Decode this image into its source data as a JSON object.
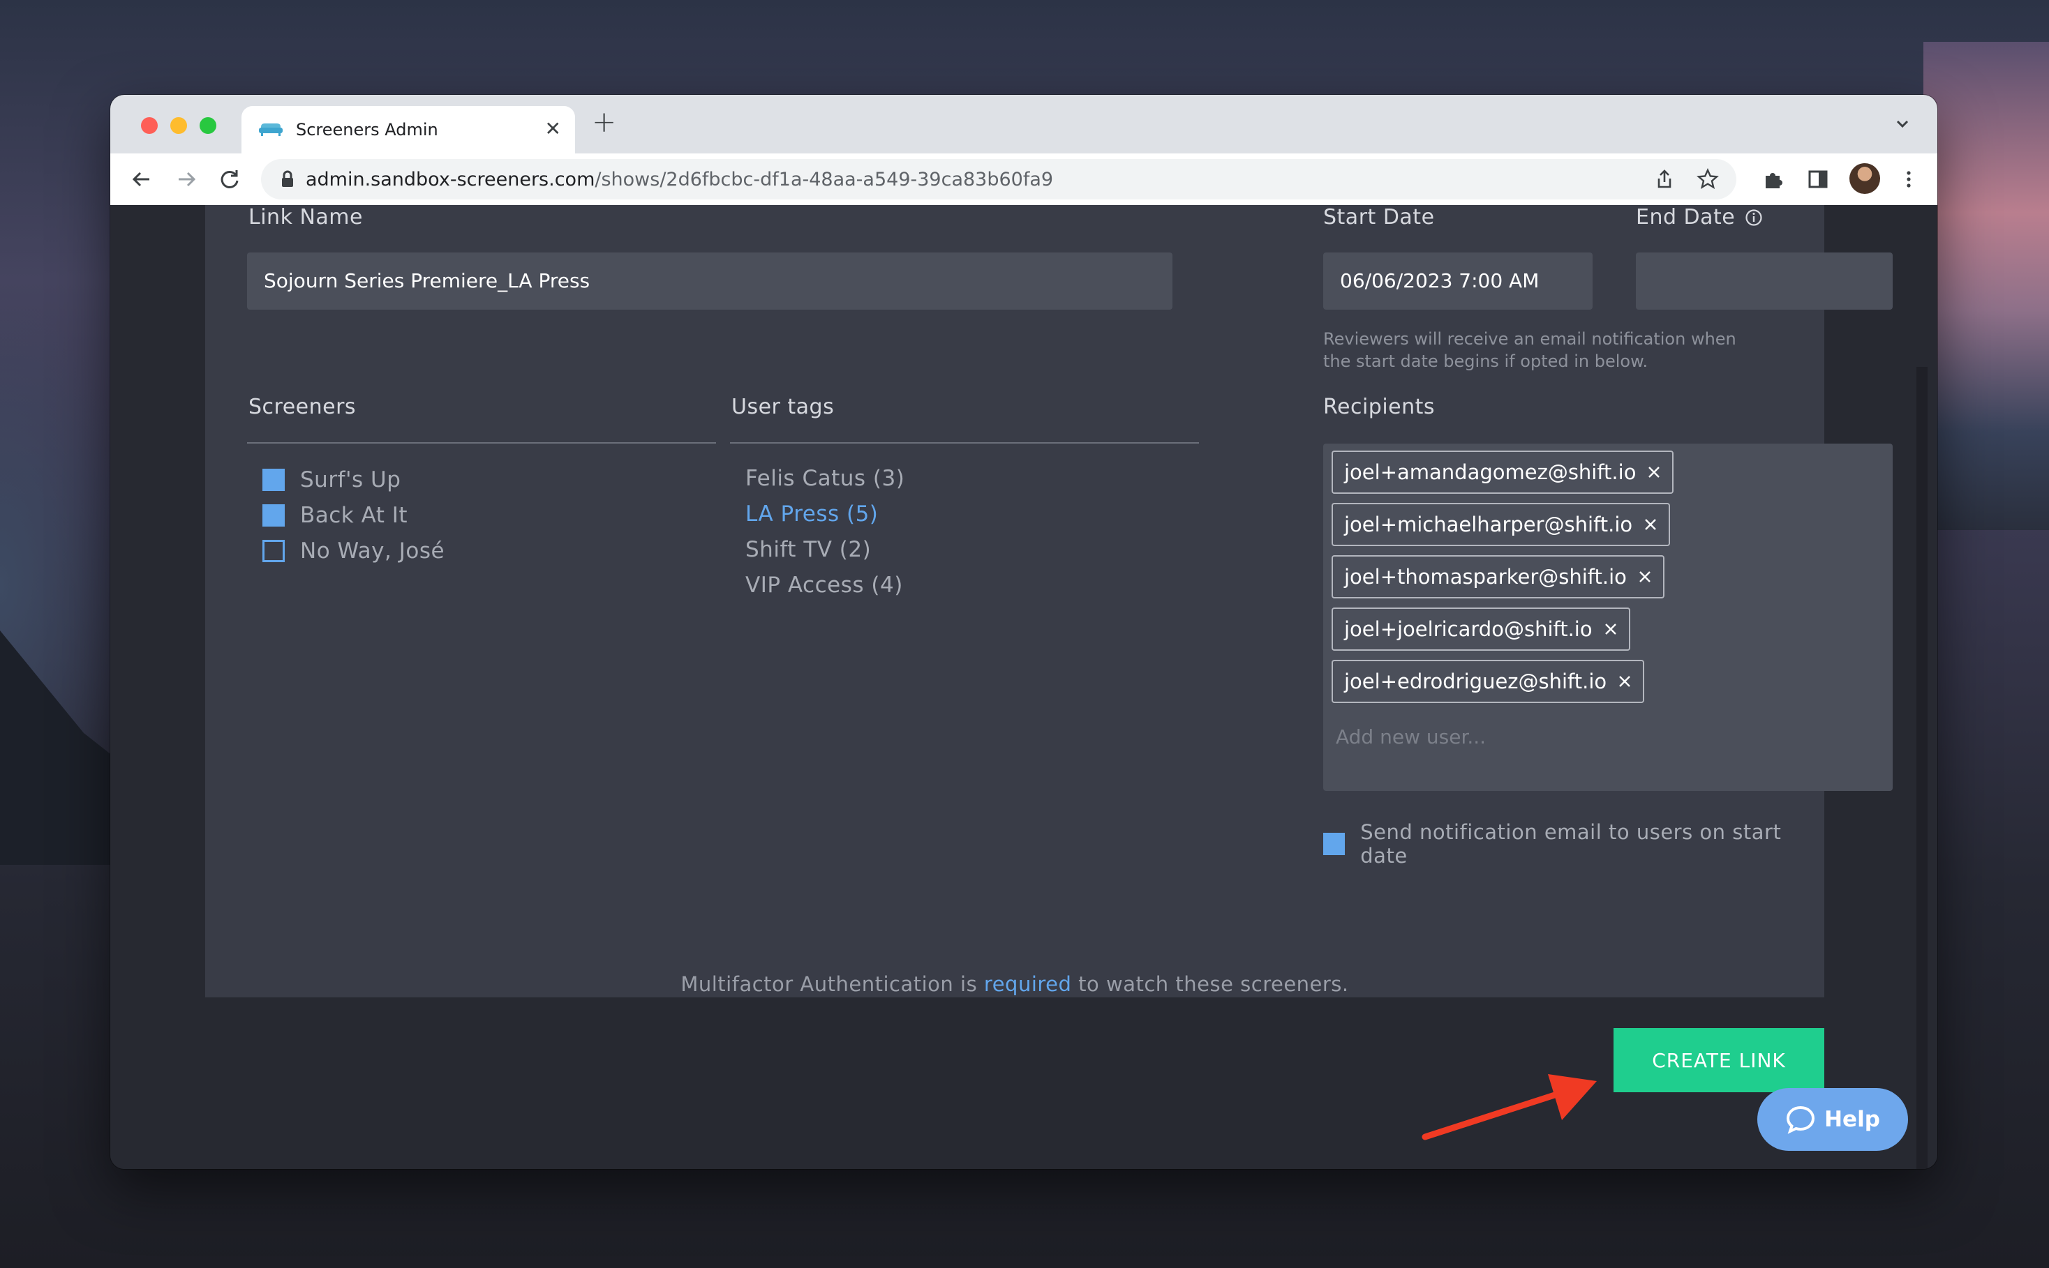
{
  "browser": {
    "tab_title": "Screeners Admin",
    "tab_close": "✕",
    "new_tab": "+",
    "url_host": "admin.sandbox-screeners.com",
    "url_path": "/shows/2d6fbcbc-df1a-48aa-a549-39ca83b60fa9"
  },
  "form": {
    "link_name_label": "Link Name",
    "link_name_value": "Sojourn Series Premiere_LA Press",
    "start_date_label": "Start Date",
    "start_date_value": "06/06/2023 7:00 AM",
    "end_date_label": "End Date",
    "end_date_value": "",
    "start_date_hint": "Reviewers will receive an email notification when the start date begins if opted in below."
  },
  "screeners": {
    "label": "Screeners",
    "items": [
      {
        "label": "Surf's Up",
        "checked": true
      },
      {
        "label": "Back At It",
        "checked": true
      },
      {
        "label": "No Way, José",
        "checked": false
      }
    ]
  },
  "user_tags": {
    "label": "User tags",
    "items": [
      {
        "label": "Felis Catus (3)",
        "active": false
      },
      {
        "label": "LA Press (5)",
        "active": true
      },
      {
        "label": "Shift TV (2)",
        "active": false
      },
      {
        "label": "VIP Access (4)",
        "active": false
      }
    ]
  },
  "recipients": {
    "label": "Recipients",
    "chips": [
      "joel+amandagomez@shift.io",
      "joel+michaelharper@shift.io",
      "joel+thomasparker@shift.io",
      "joel+joelricardo@shift.io",
      "joel+edrodriguez@shift.io"
    ],
    "add_placeholder": "Add new user..."
  },
  "notify": {
    "label": "Send notification email to users on start date",
    "checked": true
  },
  "mfa": {
    "prefix": "Multifactor Authentication is ",
    "link": "required",
    "suffix": " to watch these screeners."
  },
  "actions": {
    "create_link": "CREATE LINK",
    "help": "Help"
  },
  "colors": {
    "accent_blue": "#62a6ec",
    "create_green": "#1fce8e",
    "annotation_arrow": "#f03a23"
  }
}
